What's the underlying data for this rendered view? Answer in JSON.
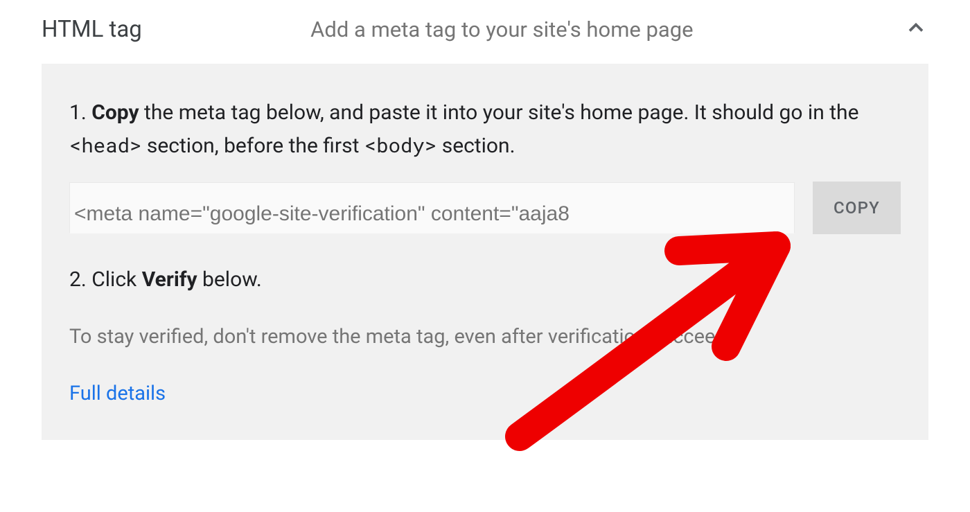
{
  "header": {
    "title": "HTML tag",
    "subtitle": "Add a meta tag to your site's home page"
  },
  "instructions": {
    "step1_num": "1. ",
    "step1_bold": "Copy",
    "step1_text1": " the meta tag below, and paste it into your site's home page. It should go in the ",
    "step1_code1": "<head>",
    "step1_text2": " section, before the first ",
    "step1_code2": "<body>",
    "step1_text3": " section.",
    "code_snippet": "<meta name=\"google-site-verification\" content=\"aaja8",
    "copy_button": "COPY",
    "step2_num": "2. Click ",
    "step2_bold": "Verify",
    "step2_text": " below.",
    "note": "To stay verified, don't remove the meta tag, even after verification succeeds.",
    "link": "Full details"
  },
  "annotation": {
    "color": "#ee0000"
  }
}
